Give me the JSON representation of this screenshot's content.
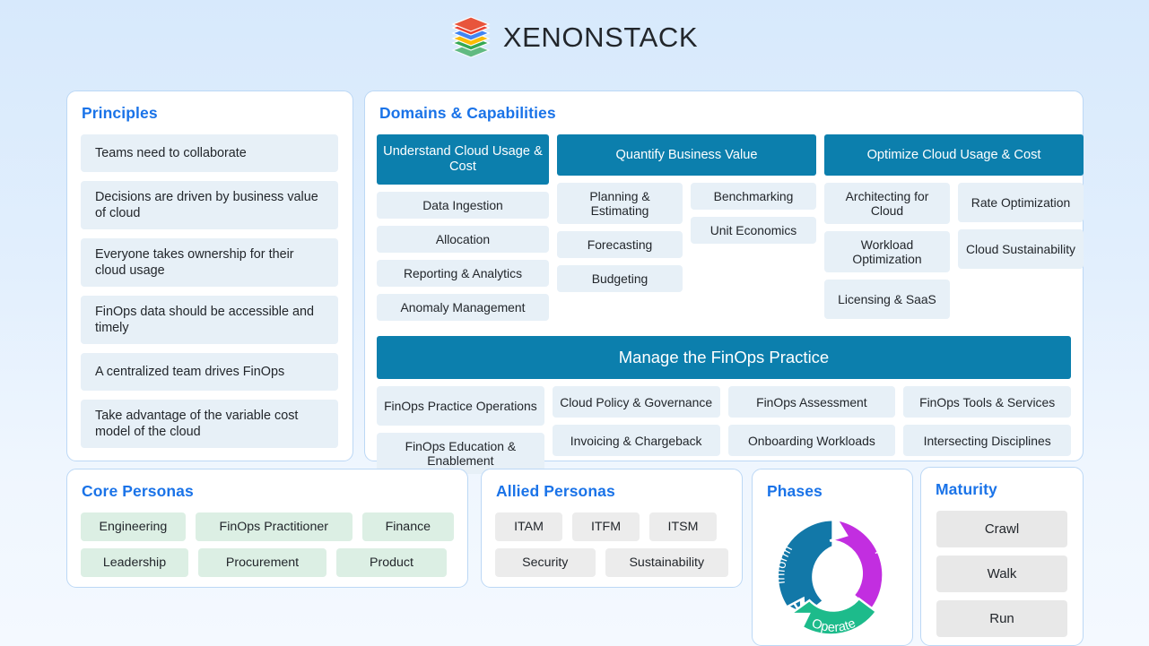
{
  "brand": {
    "name": "XENONSTACK",
    "logo_icon": "stacked-layers-logo"
  },
  "colors": {
    "accent_blue": "#1a73e8",
    "domain_header_teal": "#0c7fad",
    "chip_blue": "#e7f0f7",
    "chip_green": "#dcefe4",
    "chip_grey": "#ececec",
    "phase_inform": "#1278a8",
    "phase_optimize": "#c22ee0",
    "phase_operate": "#1dbb8b",
    "page_bg_top": "#d7e9fc",
    "page_bg_bottom": "#f4f9ff"
  },
  "principles": {
    "title": "Principles",
    "items": [
      "Teams need to collaborate",
      "Decisions are driven by business value of cloud",
      "Everyone takes ownership for their cloud usage",
      "FinOps data should be accessible and timely",
      "A centralized team drives FinOps",
      "Take advantage of the variable cost model of the cloud"
    ]
  },
  "domains": {
    "title": "Domains & Capabilities",
    "columns": [
      {
        "header": "Understand Cloud Usage & Cost",
        "capabilities": [
          "Data Ingestion",
          "Allocation",
          "Reporting & Analytics",
          "Anomaly Management"
        ]
      },
      {
        "header": "Quantify Business Value",
        "left_capabilities": [
          "Planning & Estimating",
          "Forecasting",
          "Budgeting"
        ],
        "right_capabilities": [
          "Benchmarking",
          "Unit Economics"
        ]
      },
      {
        "header": "Optimize Cloud Usage & Cost",
        "left_capabilities": [
          "Architecting for Cloud",
          "Workload Optimization",
          "Licensing & SaaS"
        ],
        "right_capabilities": [
          "Rate Optimization",
          "Cloud Sustainability"
        ]
      }
    ],
    "manage": {
      "header": "Manage the FinOps Practice",
      "col1": [
        "FinOps Practice Operations",
        "FinOps Education & Enablement"
      ],
      "col2": [
        "Cloud Policy & Governance",
        "Invoicing & Chargeback"
      ],
      "col3": [
        "FinOps Assessment",
        "Onboarding Workloads"
      ],
      "col4": [
        "FinOps Tools & Services",
        "Intersecting Disciplines"
      ]
    }
  },
  "core_personas": {
    "title": "Core Personas",
    "row1": [
      "Engineering",
      "FinOps Practitioner",
      "Finance"
    ],
    "row2": [
      "Leadership",
      "Procurement",
      "Product"
    ]
  },
  "allied_personas": {
    "title": "Allied Personas",
    "row1": [
      "ITAM",
      "ITFM",
      "ITSM"
    ],
    "row2": [
      "Security",
      "Sustainability"
    ]
  },
  "phases": {
    "title": "Phases",
    "segments": [
      {
        "label": "Inform",
        "color": "#1278a8"
      },
      {
        "label": "Optimize",
        "color": "#c22ee0"
      },
      {
        "label": "Operate",
        "color": "#1dbb8b"
      }
    ]
  },
  "maturity": {
    "title": "Maturity",
    "levels": [
      "Crawl",
      "Walk",
      "Run"
    ]
  }
}
